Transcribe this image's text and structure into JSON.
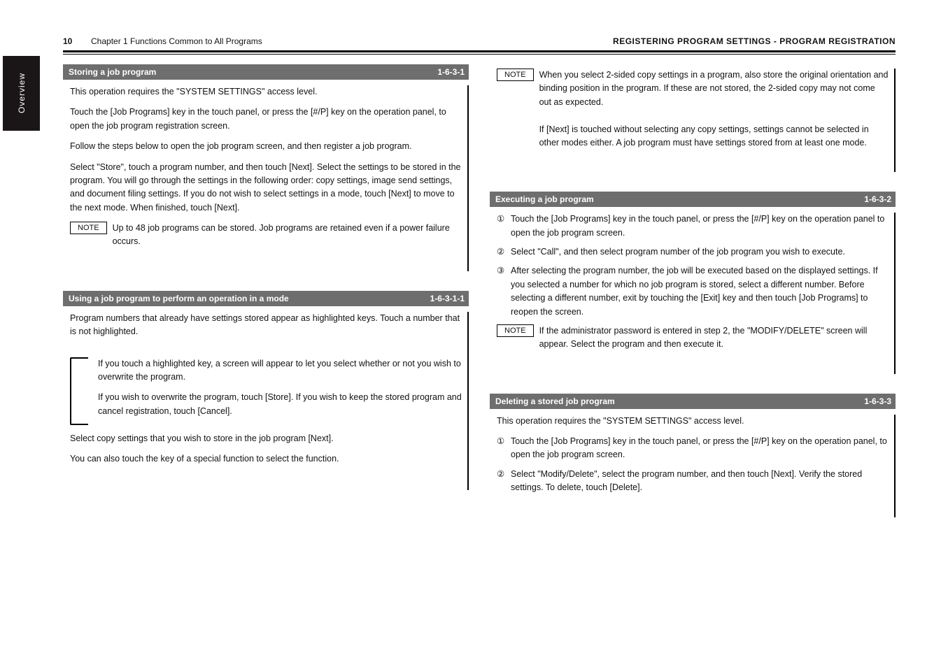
{
  "header": {
    "page_number": "10",
    "chapter": "Chapter 1 Functions Common to All Programs",
    "title": "REGISTERING PROGRAM SETTINGS - PROGRAM REGISTRATION"
  },
  "tab": {
    "label": "Overview"
  },
  "section1": {
    "heading": "Storing a job program",
    "number": "1-6-3-1",
    "p1": "This operation requires the \"SYSTEM SETTINGS\" access level.",
    "p2": "Touch the [Job Programs] key in the touch panel, or press the [#/P] key on the operation panel, to open the job program registration screen.",
    "p3": "Follow the steps below to open the job program screen, and then register a job program.",
    "p4": "Select \"Store\", touch a program number, and then touch [Next]. Select the settings to be stored in the program. You will go through the settings in the following order: copy settings, image send settings, and document filing settings. If you do not wish to select settings in a mode, touch [Next] to move to the next mode. When finished, touch [Next].",
    "note_label": "NOTE",
    "note_text": "Up to 48 job programs can be stored. Job programs are retained even if a power failure occurs."
  },
  "block_top_right": {
    "note_label": "NOTE",
    "note_text1": "When you select 2-sided copy settings in a program, also store the original orientation and binding position in the program. If these are not stored, the 2-sided copy may not come out as expected.",
    "note_text2": "If [Next] is touched without selecting any copy settings, settings cannot be selected in other modes either. A job program must have settings stored from at least one mode."
  },
  "section2r": {
    "heading": "Executing a job program",
    "number": "1-6-3-2",
    "b1_sym": "①",
    "b1_text": "Touch the [Job Programs] key in the touch panel, or press the [#/P] key on the operation panel to open the job program screen.",
    "b2_sym": "②",
    "b2_text": "Select \"Call\", and then select program number of the job program you wish to execute.",
    "b3_sym": "③",
    "b3_text": "After selecting the program number, the job will be executed based on the displayed settings. If you selected a number for which no job program is stored, select a different number. Before selecting a different number, exit by touching the [Exit] key and then touch [Job Programs] to reopen the screen.",
    "note_label": "NOTE",
    "note_text": "If the administrator password is entered in step 2, the \"MODIFY/DELETE\" screen will appear. Select the program and then execute it."
  },
  "section2": {
    "heading": "Using a job program to perform an operation in a mode",
    "number": "1-6-3-1-1",
    "p1": "Program numbers that already have settings stored appear as highlighted keys. Touch a number that is not highlighted.",
    "bracket_p1": "If you touch a highlighted key, a screen will appear to let you select whether or not you wish to overwrite the program.",
    "bracket_p2": "If you wish to overwrite the program, touch [Store]. If you wish to keep the stored program and cancel registration, touch [Cancel].",
    "p2": "Select copy settings that you wish to store in the job program [Next].",
    "p3": "You can also touch the key of a special function to select the function."
  },
  "section3r": {
    "heading": "Deleting a stored job program",
    "number": "1-6-3-3",
    "p1": "This operation requires the \"SYSTEM SETTINGS\" access level.",
    "b1_sym": "①",
    "b1_text": "Touch the [Job Programs] key in the touch panel, or press the [#/P] key on the operation panel, to open the job program screen.",
    "b2_sym": "②",
    "b2_text": "Select \"Modify/Delete\", select the program number, and then touch [Next]. Verify the stored settings. To delete, touch [Delete]."
  }
}
